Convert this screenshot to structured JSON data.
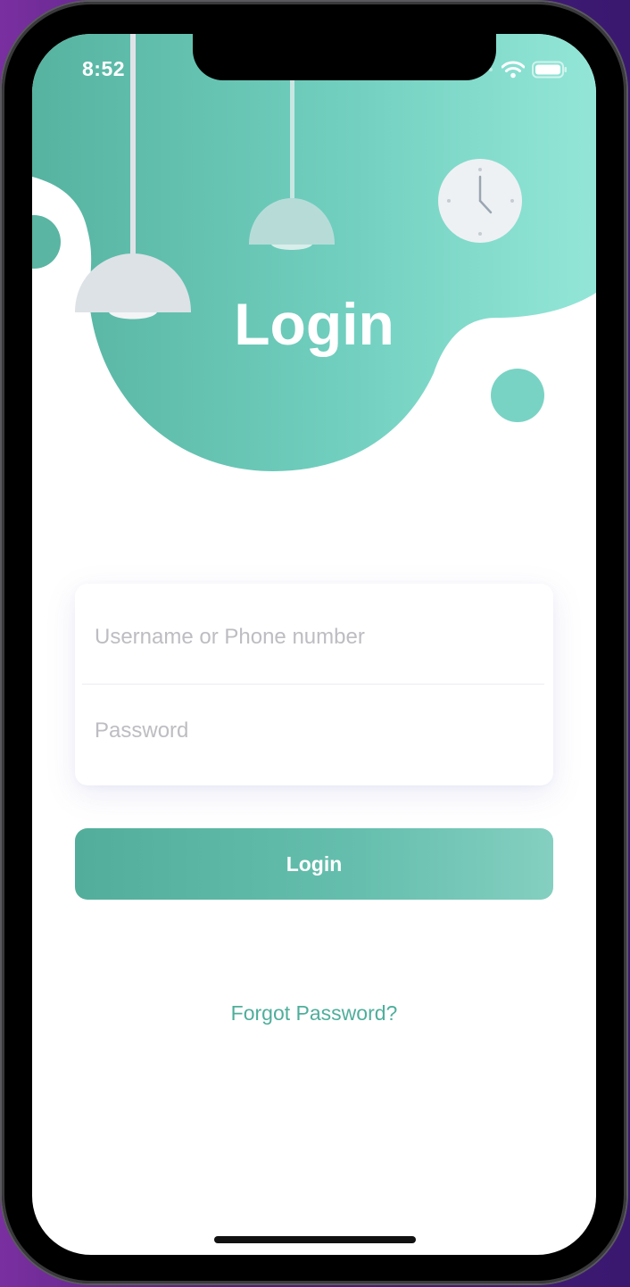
{
  "status_bar": {
    "time": "8:52",
    "signal_icon": "signal-dots-icon",
    "wifi_icon": "wifi-icon",
    "battery_icon": "battery-icon"
  },
  "header": {
    "title": "Login",
    "illustration": [
      "pendant-lamp-large",
      "pendant-lamp-small",
      "wall-clock"
    ]
  },
  "form": {
    "username": {
      "placeholder": "Username or Phone number",
      "value": ""
    },
    "password": {
      "placeholder": "Password",
      "value": ""
    }
  },
  "actions": {
    "login_label": "Login",
    "forgot_password_label": "Forgot Password?"
  },
  "colors": {
    "accent": "#52ae9a",
    "accent_light": "#8fe4d4",
    "link": "#4fae9b",
    "placeholder": "#bdbdc2"
  }
}
